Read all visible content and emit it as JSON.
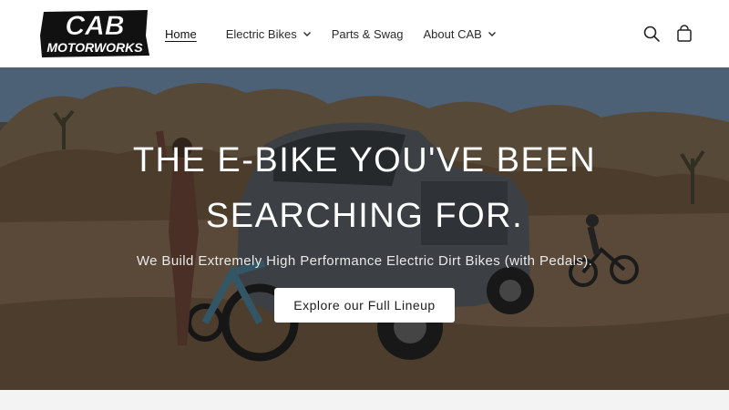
{
  "brand": {
    "logo_line1": "CAB",
    "logo_line2": "MOTORWORKS"
  },
  "nav": {
    "items": [
      {
        "label": "Home",
        "active": true,
        "has_dropdown": false
      },
      {
        "label": "Electric Bikes",
        "active": false,
        "has_dropdown": true
      },
      {
        "label": "Parts & Swag",
        "active": false,
        "has_dropdown": false
      },
      {
        "label": "About CAB",
        "active": false,
        "has_dropdown": true
      }
    ]
  },
  "header_icons": {
    "search": "search-icon",
    "cart": "cart-icon"
  },
  "hero": {
    "title_line1": "THE E-BIKE YOU'VE BEEN",
    "title_line2": "SEARCHING FOR.",
    "subtitle": "We Build Extremely High Performance Electric Dirt Bikes (with Pedals).",
    "cta_label": "Explore our Full Lineup"
  },
  "colors": {
    "header_bg": "#ffffff",
    "text": "#2b2b2b",
    "cta_bg": "#ffffff",
    "hero_text": "#ffffff"
  }
}
